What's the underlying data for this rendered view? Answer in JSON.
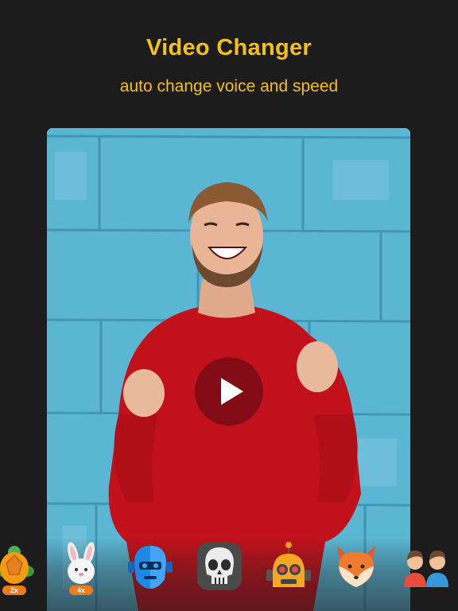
{
  "header": {
    "title": "Video Changer",
    "subtitle": "auto change voice and speed"
  },
  "preview": {
    "play_icon": "play-icon"
  },
  "effects": [
    {
      "name": "turtle",
      "icon": "turtle-icon",
      "badge": "2x"
    },
    {
      "name": "rabbit",
      "icon": "rabbit-icon",
      "badge": "4x"
    },
    {
      "name": "robot-head",
      "icon": "robot-head-icon"
    },
    {
      "name": "skull",
      "icon": "skull-icon"
    },
    {
      "name": "robot",
      "icon": "robot-icon"
    },
    {
      "name": "fox",
      "icon": "fox-icon"
    },
    {
      "name": "couple",
      "icon": "people-icon"
    }
  ],
  "colors": {
    "background": "#1c1c1c",
    "accent": "#f5c018",
    "badge": "#f07a1a"
  }
}
